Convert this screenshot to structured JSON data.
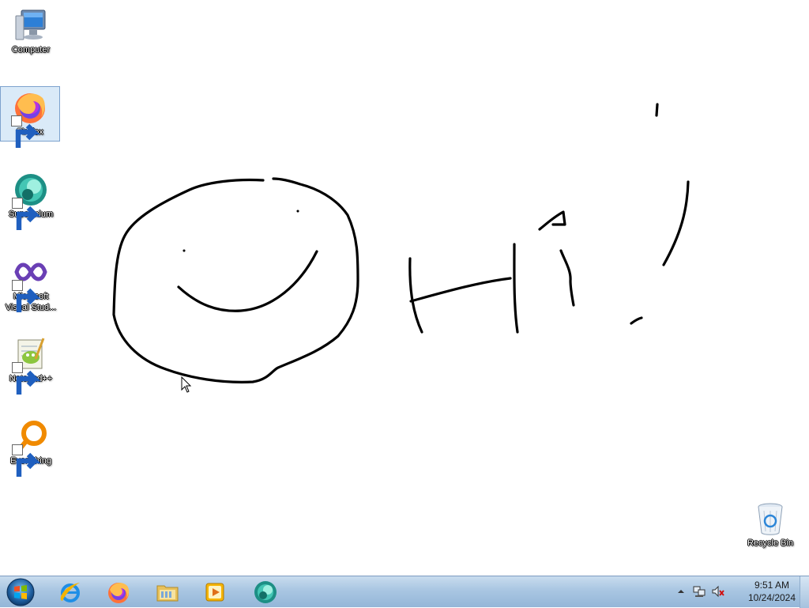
{
  "desktop": {
    "background": "#ffffff",
    "icons": [
      {
        "label": "Computer",
        "icon": "computer-icon"
      },
      {
        "label": "Firefox",
        "icon": "firefox-icon"
      },
      {
        "label": "Supermium",
        "icon": "supermium-icon"
      },
      {
        "label": "Microsoft Visual Stud...",
        "icon": "visual-studio-icon"
      },
      {
        "label": "Notepad++",
        "icon": "notepad-plus-plus-icon"
      },
      {
        "label": "Everything",
        "icon": "everything-search-icon"
      },
      {
        "label": "Recycle Bin",
        "icon": "recycle-bin-icon"
      }
    ],
    "selected_icon": "Firefox"
  },
  "drawing": {
    "description_text": "Hi!",
    "stroke_color": "#000000"
  },
  "taskbar": {
    "pinned": [
      {
        "name": "Internet Explorer",
        "icon": "internet-explorer-icon"
      },
      {
        "name": "Firefox",
        "icon": "firefox-icon"
      },
      {
        "name": "File Explorer",
        "icon": "folder-icon"
      },
      {
        "name": "Media Player",
        "icon": "media-player-icon"
      },
      {
        "name": "Supermium",
        "icon": "supermium-icon"
      }
    ],
    "tray": {
      "time": "9:51 AM",
      "date": "10/24/2024"
    }
  }
}
